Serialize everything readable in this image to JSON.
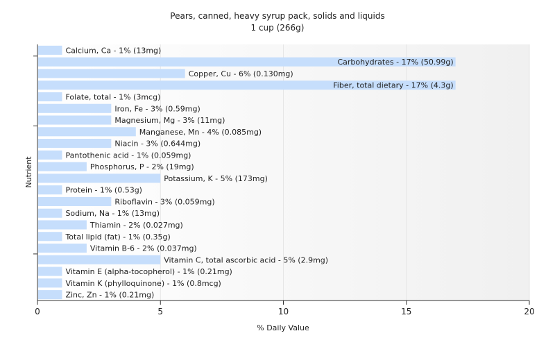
{
  "chart_data": {
    "type": "bar",
    "orientation": "horizontal",
    "title": "Pears, canned, heavy syrup pack, solids and liquids",
    "subtitle": "1 cup (266g)",
    "xlabel": "% Daily Value",
    "ylabel": "Nutrient",
    "xlim": [
      0,
      20
    ],
    "xticks": [
      0,
      5,
      10,
      15,
      20
    ],
    "grid": true,
    "legend": "none",
    "bar_color": "#c6defc",
    "categories": [
      "Calcium, Ca",
      "Carbohydrates",
      "Copper, Cu",
      "Fiber, total dietary",
      "Folate, total",
      "Iron, Fe",
      "Magnesium, Mg",
      "Manganese, Mn",
      "Niacin",
      "Pantothenic acid",
      "Phosphorus, P",
      "Potassium, K",
      "Protein",
      "Riboflavin",
      "Sodium, Na",
      "Thiamin",
      "Total lipid (fat)",
      "Vitamin B-6",
      "Vitamin C, total ascorbic acid",
      "Vitamin E (alpha-tocopherol)",
      "Vitamin K (phylloquinone)",
      "Zinc, Zn"
    ],
    "values": [
      1,
      17,
      6,
      17,
      1,
      3,
      3,
      4,
      3,
      1,
      2,
      5,
      1,
      3,
      1,
      2,
      1,
      2,
      5,
      1,
      1,
      1
    ],
    "labels": [
      "Calcium, Ca - 1% (13mg)",
      "Carbohydrates - 17% (50.99g)",
      "Copper, Cu - 6% (0.130mg)",
      "Fiber, total dietary - 17% (4.3g)",
      "Folate, total - 1% (3mcg)",
      "Iron, Fe - 3% (0.59mg)",
      "Magnesium, Mg - 3% (11mg)",
      "Manganese, Mn - 4% (0.085mg)",
      "Niacin - 3% (0.644mg)",
      "Pantothenic acid - 1% (0.059mg)",
      "Phosphorus, P - 2% (19mg)",
      "Potassium, K - 5% (173mg)",
      "Protein - 1% (0.53g)",
      "Riboflavin - 3% (0.059mg)",
      "Sodium, Na - 1% (13mg)",
      "Thiamin - 2% (0.027mg)",
      "Total lipid (fat) - 1% (0.35g)",
      "Vitamin B-6 - 2% (0.037mg)",
      "Vitamin C, total ascorbic acid - 5% (2.9mg)",
      "Vitamin E (alpha-tocopherol) - 1% (0.21mg)",
      "Vitamin K (phylloquinone) - 1% (0.8mcg)",
      "Zinc, Zn - 1% (0.21mg)"
    ]
  }
}
